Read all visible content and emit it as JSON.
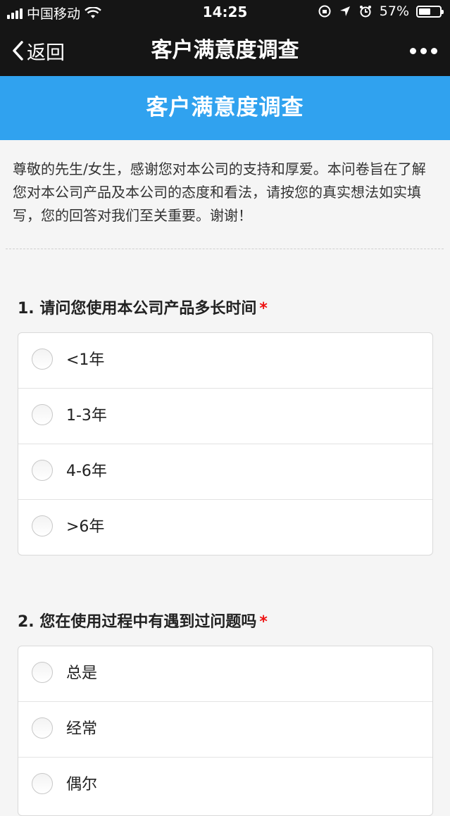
{
  "status_bar": {
    "carrier": "中国移动",
    "time": "14:25",
    "battery_percent": "57%",
    "battery_level": 0.57
  },
  "nav": {
    "back_label": "返回",
    "title": "客户满意度调查"
  },
  "survey": {
    "header": "客户满意度调查",
    "intro": "尊敬的先生/女生，感谢您对本公司的支持和厚爱。本问卷旨在了解您对本公司产品及本公司的态度和看法，请按您的真实想法如实填写，您的回答对我们至关重要。谢谢！",
    "questions": [
      {
        "title": "1. 请问您使用本公司产品多长时间",
        "required_mark": "*",
        "options": [
          "<1年",
          "1-3年",
          "4-6年",
          ">6年"
        ]
      },
      {
        "title": "2. 您在使用过程中有遇到过问题吗",
        "required_mark": "*",
        "options": [
          "总是",
          "经常",
          "偶尔"
        ]
      }
    ]
  },
  "colors": {
    "header_blue": "#30a2ef",
    "bar_dark": "#151515",
    "required_red": "#e11"
  }
}
